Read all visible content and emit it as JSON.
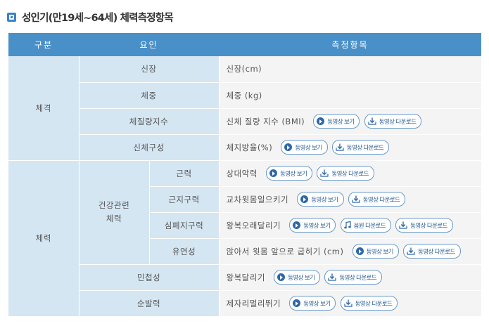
{
  "title": "성인기(만19세~64세) 체력측정항목",
  "headers": {
    "category": "구분",
    "factor": "요인",
    "items": "측정항목"
  },
  "buttons": {
    "video": "동영상 보기",
    "download": "동영상 다운로드",
    "audio": "음원 다운로드"
  },
  "categories": {
    "physique": "체격",
    "fitness": "체력"
  },
  "factors": {
    "height": "신장",
    "weight": "체중",
    "bmi": "체질량지수",
    "body_comp": "신체구성",
    "health_group_line1": "건강관련",
    "health_group_line2": "체력",
    "strength": "근력",
    "endurance": "근지구력",
    "cardio": "심폐지구력",
    "flexibility": "유연성",
    "agility": "민첩성",
    "power": "순발력"
  },
  "items": {
    "height": "신장(cm)",
    "weight": "체중 (kg)",
    "bmi": "신체 질량 지수 (BMI)",
    "body_comp": "체지방율(%)",
    "strength": "상대악력",
    "endurance": "교차윗몸일으키기",
    "cardio": "왕복오래달리기",
    "flexibility": "앉아서 윗몸 앞으로 굽히기 (cm)",
    "agility": "왕복달리기",
    "power": "제자리멀리뛰기"
  },
  "colors": {
    "header": "#4a90c8",
    "category_bg": "#d5e6f3",
    "item_bg": "#f4f4f4",
    "button_border": "#6a9ac8"
  }
}
